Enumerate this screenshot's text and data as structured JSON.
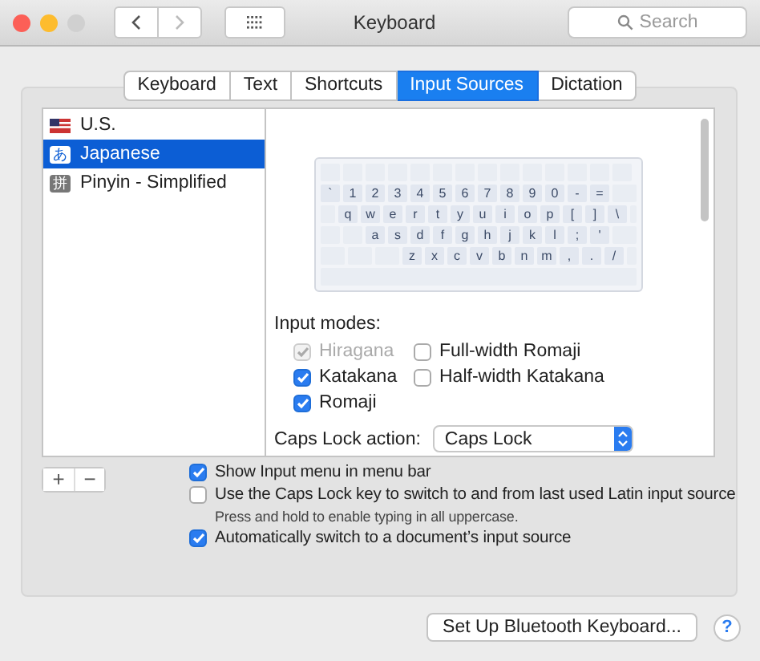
{
  "window": {
    "title": "Keyboard"
  },
  "search": {
    "placeholder": "Search"
  },
  "tabs": [
    {
      "label": "Keyboard",
      "selected": false
    },
    {
      "label": "Text",
      "selected": false
    },
    {
      "label": "Shortcuts",
      "selected": false
    },
    {
      "label": "Input Sources",
      "selected": true
    },
    {
      "label": "Dictation",
      "selected": false
    }
  ],
  "sources": [
    {
      "label": "U.S.",
      "kind": "flag",
      "selected": false
    },
    {
      "label": "Japanese",
      "kind": "kana",
      "glyph": "あ",
      "selected": true
    },
    {
      "label": "Pinyin - Simplified",
      "kind": "hanzi",
      "glyph": "拼",
      "selected": false
    }
  ],
  "keyboard": {
    "rows": [
      [
        "`",
        "1",
        "2",
        "3",
        "4",
        "5",
        "6",
        "7",
        "8",
        "9",
        "0",
        "-",
        "="
      ],
      [
        "q",
        "w",
        "e",
        "r",
        "t",
        "y",
        "u",
        "i",
        "o",
        "p",
        "[",
        "]",
        "\\"
      ],
      [
        "a",
        "s",
        "d",
        "f",
        "g",
        "h",
        "j",
        "k",
        "l",
        ";",
        "'"
      ],
      [
        "z",
        "x",
        "c",
        "v",
        "b",
        "n",
        "m",
        ",",
        ".",
        "/"
      ]
    ]
  },
  "input_modes": {
    "label": "Input modes:",
    "items": [
      {
        "label": "Hiragana",
        "checked": true,
        "disabled": true
      },
      {
        "label": "Full-width Romaji",
        "checked": false,
        "disabled": false
      },
      {
        "label": "Katakana",
        "checked": true,
        "disabled": false
      },
      {
        "label": "Half-width Katakana",
        "checked": false,
        "disabled": false
      },
      {
        "label": "Romaji",
        "checked": true,
        "disabled": false
      }
    ]
  },
  "caps_lock_action": {
    "label": "Caps Lock action:",
    "value": "Caps Lock"
  },
  "list_buttons": [
    "+",
    "−"
  ],
  "options": [
    {
      "label": "Show Input menu in menu bar",
      "checked": true
    },
    {
      "label": "Use the Caps Lock key to switch to and from last used Latin input source",
      "checked": false,
      "note": "Press and hold to enable typing in all uppercase."
    },
    {
      "label": "Automatically switch to a document’s input source",
      "checked": true
    }
  ],
  "bluetooth_button": "Set Up Bluetooth Keyboard...",
  "help": "?"
}
